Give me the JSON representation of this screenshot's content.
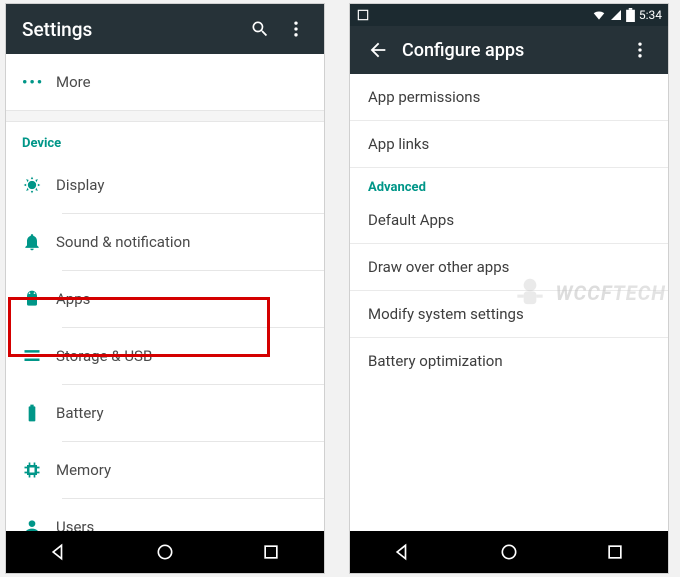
{
  "left": {
    "title": "Settings",
    "more": "More",
    "section_device": "Device",
    "items": {
      "display": "Display",
      "sound": "Sound & notification",
      "apps": "Apps",
      "storage": "Storage & USB",
      "battery": "Battery",
      "memory": "Memory",
      "users": "Users"
    }
  },
  "right": {
    "time": "5:34",
    "title": "Configure apps",
    "items": {
      "permissions": "App permissions",
      "links": "App links",
      "advanced": "Advanced",
      "default": "Default Apps",
      "draw": "Draw over other apps",
      "modify": "Modify system settings",
      "battery_opt": "Battery optimization"
    }
  },
  "watermark": "WCCF"
}
